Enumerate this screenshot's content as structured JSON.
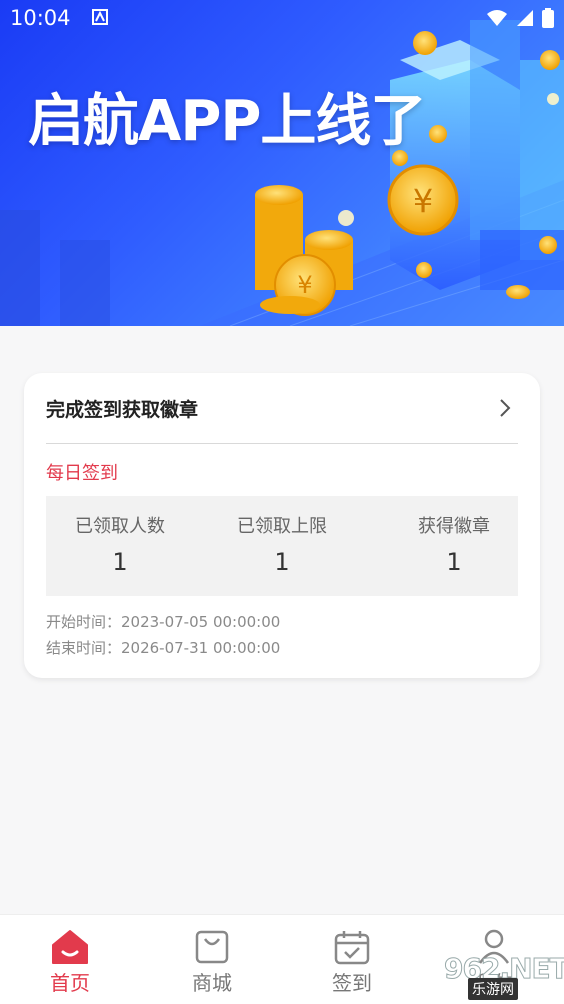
{
  "status_bar": {
    "time": "10:04"
  },
  "banner": {
    "title": "启航APP上线了"
  },
  "card": {
    "title": "完成签到获取徽章",
    "daily_label": "每日签到",
    "stats": [
      {
        "label": "已领取人数",
        "value": "1"
      },
      {
        "label": "已领取上限",
        "value": "1"
      },
      {
        "label": "获得徽章",
        "value": "1"
      }
    ],
    "start_time": "开始时间：2023-07-05 00:00:00",
    "end_time": "结束时间：2026-07-31 00:00:00"
  },
  "tabbar": {
    "tabs": [
      {
        "label": "首页",
        "icon": "home-icon",
        "active": true
      },
      {
        "label": "商城",
        "icon": "shopping-bag-icon",
        "active": false
      },
      {
        "label": "签到",
        "icon": "calendar-check-icon",
        "active": false
      },
      {
        "label": "我的",
        "icon": "user-icon",
        "active": false
      }
    ]
  },
  "watermark": {
    "text": "962.NET",
    "sub": "乐游网"
  },
  "colors": {
    "accent": "#e23a4c",
    "banner_blue": "#2f5cff",
    "coin_gold": "#f6b51c"
  }
}
